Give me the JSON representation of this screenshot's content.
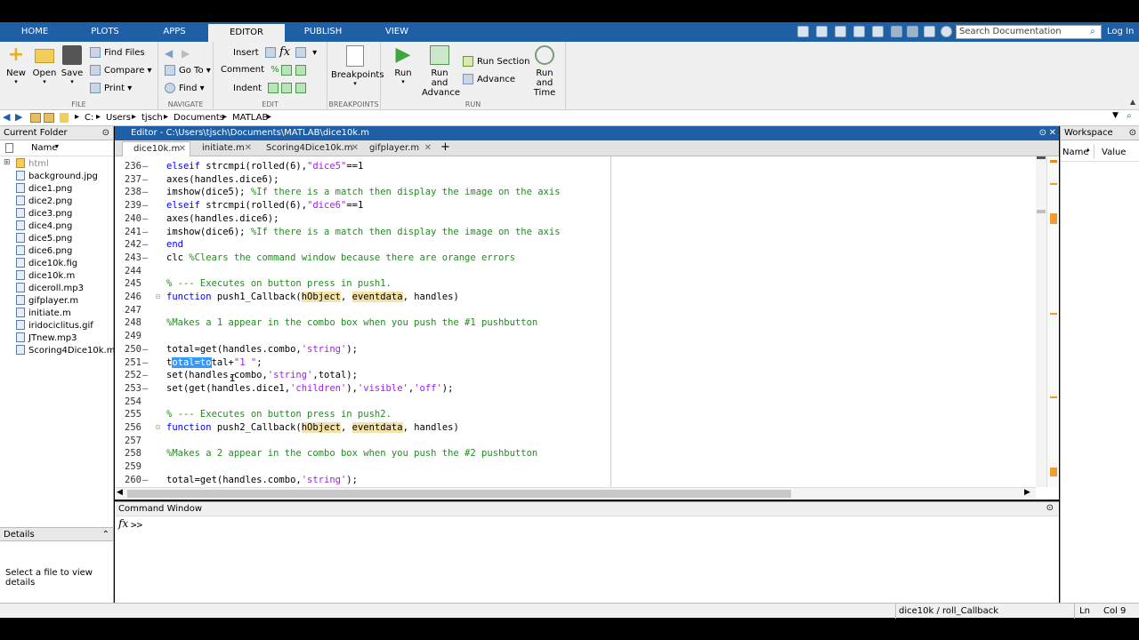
{
  "toptabs": [
    "HOME",
    "PLOTS",
    "APPS",
    "EDITOR",
    "PUBLISH",
    "VIEW"
  ],
  "search_placeholder": "Search Documentation",
  "login": "Log In",
  "ribbon": {
    "new": "New",
    "open": "Open",
    "save": "Save",
    "find_files": "Find Files",
    "compare": "Compare",
    "print": "Print",
    "go_to": "Go To",
    "find": "Find",
    "insert": "Insert",
    "comment": "Comment",
    "indent": "Indent",
    "breakpoints": "Breakpoints",
    "run": "Run",
    "run_and_advance_1": "Run and",
    "run_and_advance_2": "Advance",
    "run_section": "Run Section",
    "advance": "Advance",
    "run_and_time_1": "Run and",
    "run_and_time_2": "Time",
    "sections": [
      "FILE",
      "NAVIGATE",
      "EDIT",
      "BREAKPOINTS",
      "RUN"
    ]
  },
  "address": [
    "C:",
    "Users",
    "tjsch",
    "Documents",
    "MATLAB"
  ],
  "current_folder": {
    "title": "Current Folder",
    "name_col": "Name",
    "files": [
      "html",
      "background.jpg",
      "dice1.png",
      "dice2.png",
      "dice3.png",
      "dice4.png",
      "dice5.png",
      "dice6.png",
      "dice10k.fig",
      "dice10k.m",
      "diceroll.mp3",
      "gifplayer.m",
      "initiate.m",
      "iridociclitus.gif",
      "JTnew.mp3",
      "Scoring4Dice10k.m"
    ]
  },
  "details": {
    "title": "Details",
    "message": "Select a file to view details"
  },
  "editor": {
    "title": "Editor - C:\\Users\\tjsch\\Documents\\MATLAB\\dice10k.m",
    "tabs": [
      "dice10k.m",
      "initiate.m",
      "Scoring4Dice10k.m",
      "gifplayer.m"
    ],
    "add_tab": "+"
  },
  "code_lines": [
    {
      "n": "236",
      "d": "–",
      "segs": [
        [
          "kw",
          "elseif "
        ],
        [
          "",
          "strcmpi(rolled(6),"
        ],
        [
          "str",
          "\"dice5\""
        ],
        [
          "",
          "==1"
        ]
      ]
    },
    {
      "n": "237",
      "d": "–",
      "segs": [
        [
          "",
          "axes(handles.dice6);"
        ]
      ]
    },
    {
      "n": "238",
      "d": "–",
      "segs": [
        [
          "",
          "imshow(dice5); "
        ],
        [
          "cm",
          "%If there is a match then display the image on the axis"
        ]
      ]
    },
    {
      "n": "239",
      "d": "–",
      "segs": [
        [
          "kw",
          "elseif "
        ],
        [
          "",
          "strcmpi(rolled(6),"
        ],
        [
          "str",
          "\"dice6\""
        ],
        [
          "",
          "==1"
        ]
      ]
    },
    {
      "n": "240",
      "d": "–",
      "segs": [
        [
          "",
          "axes(handles.dice6);"
        ]
      ]
    },
    {
      "n": "241",
      "d": "–",
      "segs": [
        [
          "",
          "imshow(dice6); "
        ],
        [
          "cm",
          "%If there is a match then display the image on the axis"
        ]
      ]
    },
    {
      "n": "242",
      "d": "–",
      "segs": [
        [
          "kw",
          "end"
        ]
      ]
    },
    {
      "n": "243",
      "d": "–",
      "segs": [
        [
          "",
          "clc "
        ],
        [
          "cm",
          "%Clears the command window because there are orange errors"
        ]
      ]
    },
    {
      "n": "244",
      "d": "",
      "segs": []
    },
    {
      "n": "245",
      "d": "",
      "segs": [
        [
          "cm",
          "% --- Executes on button press in push1."
        ]
      ]
    },
    {
      "n": "246",
      "d": "",
      "segs": [
        [
          "kw",
          "function "
        ],
        [
          "",
          "push1_Callback("
        ],
        [
          "hl",
          "hObject"
        ],
        [
          "",
          ", "
        ],
        [
          "hl",
          "eventdata"
        ],
        [
          "",
          ", handles)"
        ]
      ]
    },
    {
      "n": "247",
      "d": "",
      "segs": []
    },
    {
      "n": "248",
      "d": "",
      "segs": [
        [
          "cm",
          "%Makes a 1 appear in the combo box when you push the #1 pushbutton"
        ]
      ]
    },
    {
      "n": "249",
      "d": "",
      "segs": []
    },
    {
      "n": "250",
      "d": "–",
      "segs": [
        [
          "",
          "total=get(handles.combo,"
        ],
        [
          "str",
          "'string'"
        ],
        [
          "",
          ");"
        ]
      ]
    },
    {
      "n": "251",
      "d": "–",
      "segs": [
        [
          "",
          "t"
        ],
        [
          "sel",
          "otal=to"
        ],
        [
          "",
          "tal+"
        ],
        [
          "str",
          "\"1 \""
        ],
        [
          "",
          ";"
        ]
      ]
    },
    {
      "n": "252",
      "d": "–",
      "segs": [
        [
          "",
          "set(handles.combo,"
        ],
        [
          "str",
          "'string'"
        ],
        [
          "",
          ",total);"
        ]
      ]
    },
    {
      "n": "253",
      "d": "–",
      "segs": [
        [
          "",
          "set(get(handles.dice1,"
        ],
        [
          "str",
          "'children'"
        ],
        [
          "",
          ")"
        ],
        [
          "",
          ","
        ],
        [
          "str",
          "'visible'"
        ],
        [
          "",
          ","
        ],
        [
          "str",
          "'off'"
        ],
        [
          "",
          ");"
        ]
      ]
    },
    {
      "n": "254",
      "d": "",
      "segs": []
    },
    {
      "n": "255",
      "d": "",
      "segs": [
        [
          "cm",
          "% --- Executes on button press in push2."
        ]
      ]
    },
    {
      "n": "256",
      "d": "",
      "segs": [
        [
          "kw",
          "function "
        ],
        [
          "",
          "push2_Callback("
        ],
        [
          "hl",
          "hObject"
        ],
        [
          "",
          ", "
        ],
        [
          "hl",
          "eventdata"
        ],
        [
          "",
          ", handles)"
        ]
      ]
    },
    {
      "n": "257",
      "d": "",
      "segs": []
    },
    {
      "n": "258",
      "d": "",
      "segs": [
        [
          "cm",
          "%Makes a 2 appear in the combo box when you push the #2 pushbutton"
        ]
      ]
    },
    {
      "n": "259",
      "d": "",
      "segs": []
    },
    {
      "n": "260",
      "d": "–",
      "segs": [
        [
          "",
          "total=get(handles.combo,"
        ],
        [
          "str",
          "'string'"
        ],
        [
          "",
          ");"
        ]
      ]
    }
  ],
  "command_window": {
    "title": "Command Window",
    "prompt_icon": "fx",
    "prompt": ">>"
  },
  "workspace": {
    "title": "Workspace",
    "name_col": "Name",
    "value_col": "Value"
  },
  "status": {
    "function": "dice10k / roll_Callback",
    "ln": "Ln",
    "col": "Col  9"
  }
}
